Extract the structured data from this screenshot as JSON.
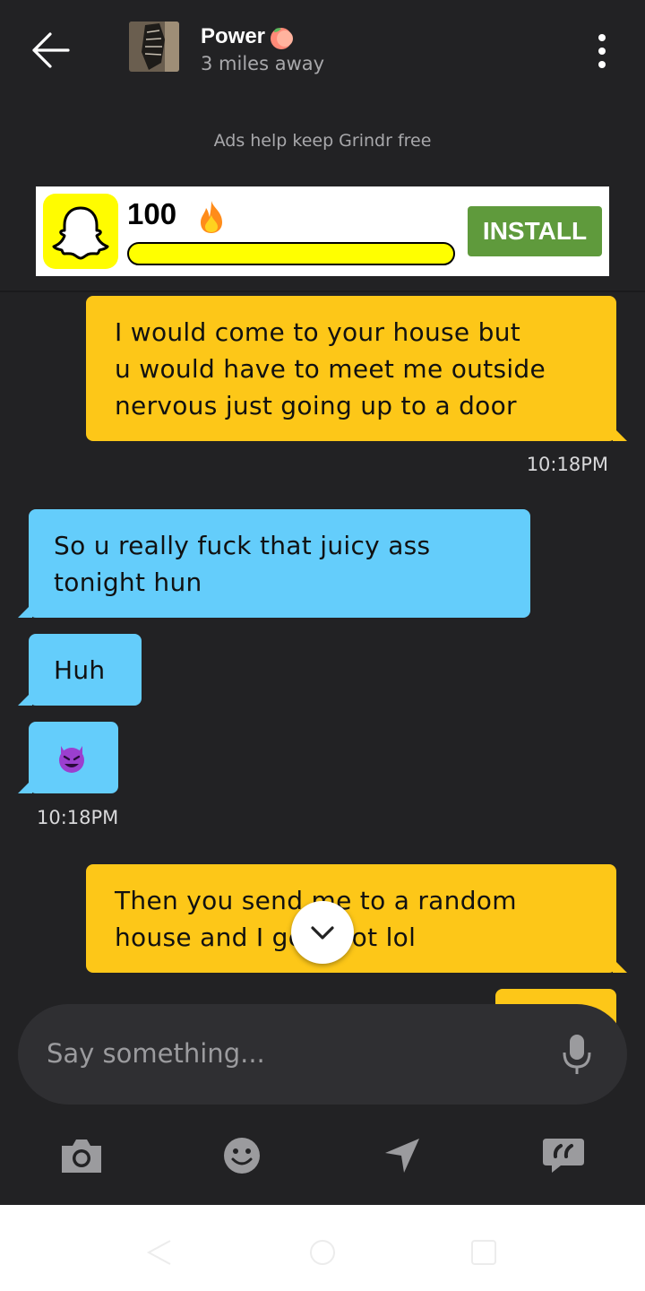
{
  "header": {
    "back_icon": "back-arrow-icon",
    "name": "Power",
    "name_emoji": "peach-emoji",
    "distance": "3 miles away",
    "menu_icon": "more-vertical-icon"
  },
  "ad": {
    "notice": "Ads help keep Grindr free",
    "logo": "snapchat-ghost-icon",
    "score": "100",
    "score_emoji": "fire-emoji",
    "progress": 1.0,
    "install_label": "INSTALL",
    "colors": {
      "snap_yellow": "#fffc00",
      "install_green": "#5f9a3c"
    }
  },
  "messages": [
    {
      "direction": "out",
      "text": "I would come to your house but\nu would have to meet me outside\nnervous just going up to a door"
    },
    {
      "direction": "out",
      "time": "10:18PM"
    },
    {
      "direction": "in",
      "text": "So u really fuck that juicy ass\ntonight hun"
    },
    {
      "direction": "in",
      "text": "Huh"
    },
    {
      "direction": "in",
      "emoji": "smiling-devil-emoji"
    },
    {
      "direction": "in",
      "time": "10:18PM"
    },
    {
      "direction": "out",
      "text": "Then you send me to a random\nhouse and I get shot lol"
    }
  ],
  "composer": {
    "placeholder": "Say something...",
    "mic_icon": "microphone-icon"
  },
  "toolbar": {
    "icons": [
      "camera-icon",
      "emoji-icon",
      "location-arrow-icon",
      "saved-phrases-icon"
    ]
  },
  "colors": {
    "background": "#222224",
    "outgoing_bubble": "#fdc718",
    "incoming_bubble": "#64cdfb"
  }
}
